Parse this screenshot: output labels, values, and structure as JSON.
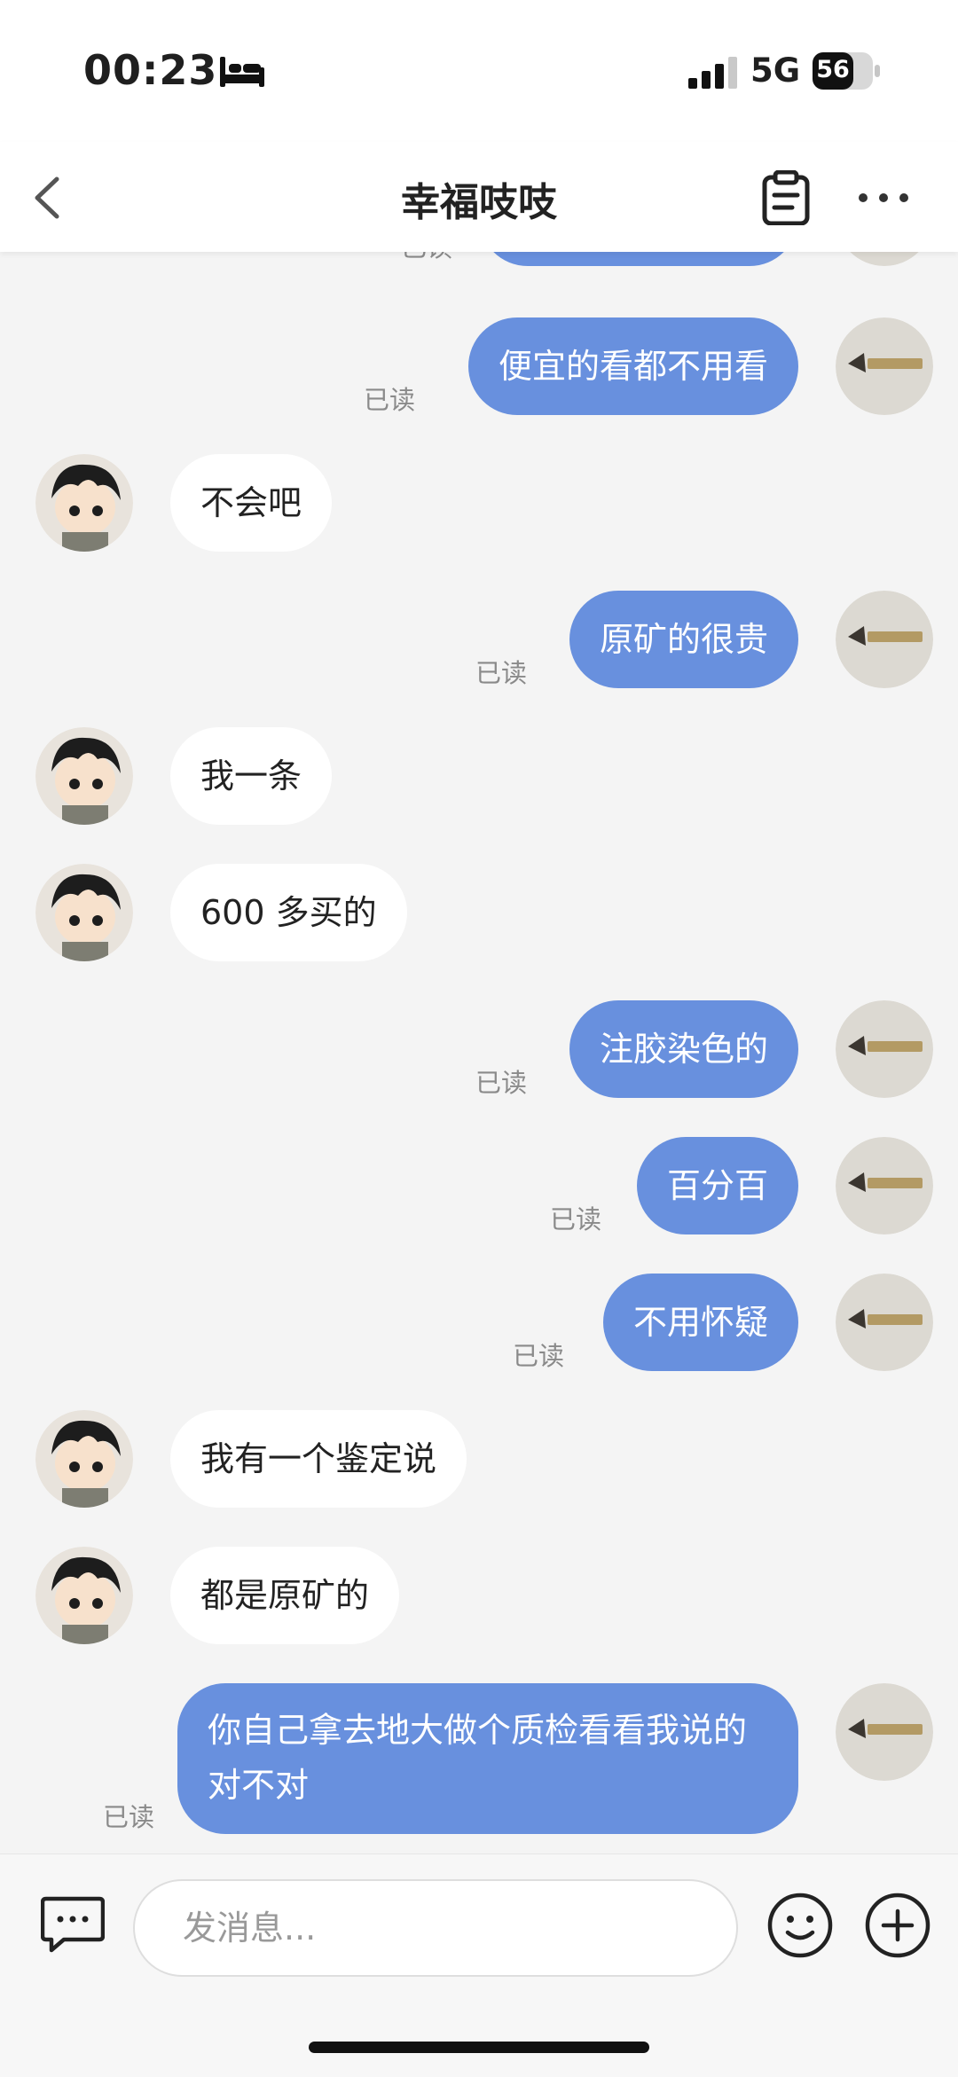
{
  "status_bar": {
    "time": "00:23",
    "network": "5G",
    "battery": "56"
  },
  "header": {
    "title": "幸福吱吱"
  },
  "messages": [
    {
      "side": "right",
      "text": "",
      "read": "已读"
    },
    {
      "side": "right",
      "text": "便宜的看都不用看",
      "read": "已读"
    },
    {
      "side": "left",
      "text": "不会吧"
    },
    {
      "side": "right",
      "text": "原矿的很贵",
      "read": "已读"
    },
    {
      "side": "left",
      "text": "我一条"
    },
    {
      "side": "left",
      "text": "600 多买的"
    },
    {
      "side": "right",
      "text": "注胶染色的",
      "read": "已读"
    },
    {
      "side": "right",
      "text": "百分百",
      "read": "已读"
    },
    {
      "side": "right",
      "text": "不用怀疑",
      "read": "已读"
    },
    {
      "side": "left",
      "text": "我有一个鉴定说"
    },
    {
      "side": "left",
      "text": "都是原矿的"
    },
    {
      "side": "right",
      "text": "你自己拿去地大做个质检看看我说的对不对",
      "read": "已读"
    }
  ],
  "composer": {
    "placeholder": "发消息..."
  },
  "icons": {
    "back": "chevron-left-icon",
    "clipboard": "clipboard-icon",
    "more": "more-dots-icon",
    "keyboard": "chat-keyboard-icon",
    "emoji": "emoji-icon",
    "plus": "plus-icon"
  },
  "colors": {
    "outgoing_bubble": "#6890de",
    "incoming_bubble": "#ffffff",
    "background": "#f4f4f4"
  }
}
